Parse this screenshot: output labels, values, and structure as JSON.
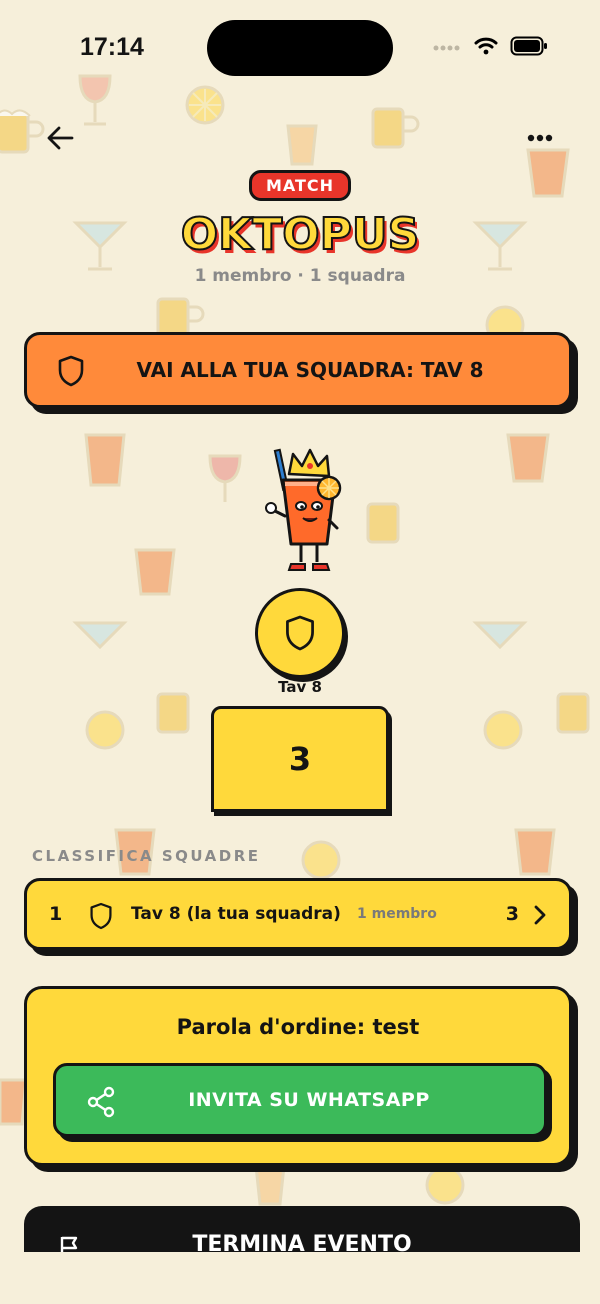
{
  "status_bar": {
    "time": "17:14"
  },
  "header": {
    "badge": "MATCH",
    "title": "OKTOPUS",
    "subtitle": "1 membro · 1 squadra"
  },
  "team_button": {
    "label": "VAI ALLA TUA SQUADRA: TAV 8"
  },
  "podium": {
    "first": {
      "team_name": "Tav 8",
      "score": "3"
    }
  },
  "leaderboard": {
    "section_title": "CLASSIFICA SQUADRE",
    "rows": [
      {
        "position": "1",
        "name": "Tav 8 (la tua squadra)",
        "members": "1 membro",
        "score": "3"
      }
    ]
  },
  "invite": {
    "password_text": "Parola d'ordine: test",
    "whatsapp_label": "INVITA SU WHATSAPP"
  },
  "end_event": {
    "label": "TERMINA EVENTO"
  },
  "colors": {
    "background": "#f6efda",
    "accent_yellow": "#ffd93b",
    "accent_orange": "#ff8a3a",
    "badge_red": "#e8352a",
    "whatsapp_green": "#3cba5a",
    "ink": "#141414"
  },
  "icons": {
    "back": "arrow-left-icon",
    "more": "ellipsis-icon",
    "team": "shield-icon",
    "row_chevron": "chevron-right-icon",
    "share": "share-icon",
    "end": "flag-icon"
  }
}
